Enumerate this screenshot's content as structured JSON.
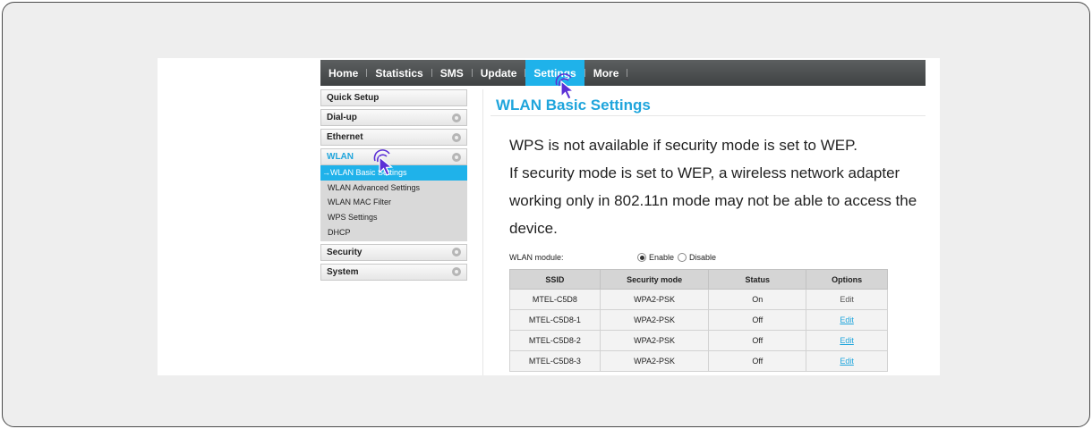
{
  "nav": {
    "items": [
      {
        "label": "Home",
        "active": false
      },
      {
        "label": "Statistics",
        "active": false
      },
      {
        "label": "SMS",
        "active": false
      },
      {
        "label": "Update",
        "active": false
      },
      {
        "label": "Settings",
        "active": true
      },
      {
        "label": "More",
        "active": false
      }
    ]
  },
  "sidebar": {
    "quick_setup": "Quick Setup",
    "dialup": "Dial-up",
    "ethernet": "Ethernet",
    "wlan": "WLAN",
    "wlan_sub": [
      {
        "label": "WLAN Basic Settings",
        "active": true
      },
      {
        "label": "WLAN Advanced Settings",
        "active": false
      },
      {
        "label": "WLAN MAC Filter",
        "active": false
      },
      {
        "label": "WPS Settings",
        "active": false
      },
      {
        "label": "DHCP",
        "active": false
      }
    ],
    "security": "Security",
    "system": "System"
  },
  "main": {
    "title": "WLAN Basic Settings",
    "notice_line1": "WPS is not available if security mode is set to WEP.",
    "notice_line2": "If security mode is set to WEP, a wireless network adapter working only in 802.11n mode may not be able to access the device.",
    "module_label": "WLAN module:",
    "enable_label": "Enable",
    "disable_label": "Disable",
    "module_state": "Enable"
  },
  "table": {
    "headers": [
      "SSID",
      "Security mode",
      "Status",
      "Options"
    ],
    "rows": [
      {
        "ssid": "MTEL-C5D8",
        "security": "WPA2-PSK",
        "status": "On",
        "option": "Edit"
      },
      {
        "ssid": "MTEL-C5D8-1",
        "security": "WPA2-PSK",
        "status": "Off",
        "option": "Edit"
      },
      {
        "ssid": "MTEL-C5D8-2",
        "security": "WPA2-PSK",
        "status": "Off",
        "option": "Edit"
      },
      {
        "ssid": "MTEL-C5D8-3",
        "security": "WPA2-PSK",
        "status": "Off",
        "option": "Edit"
      }
    ]
  },
  "colors": {
    "accent": "#1fb2ea",
    "cursor": "#5b2fd6"
  },
  "icons": {
    "menu_expand": "circle-arrow-icon",
    "pointer": "click-pointer-icon"
  }
}
